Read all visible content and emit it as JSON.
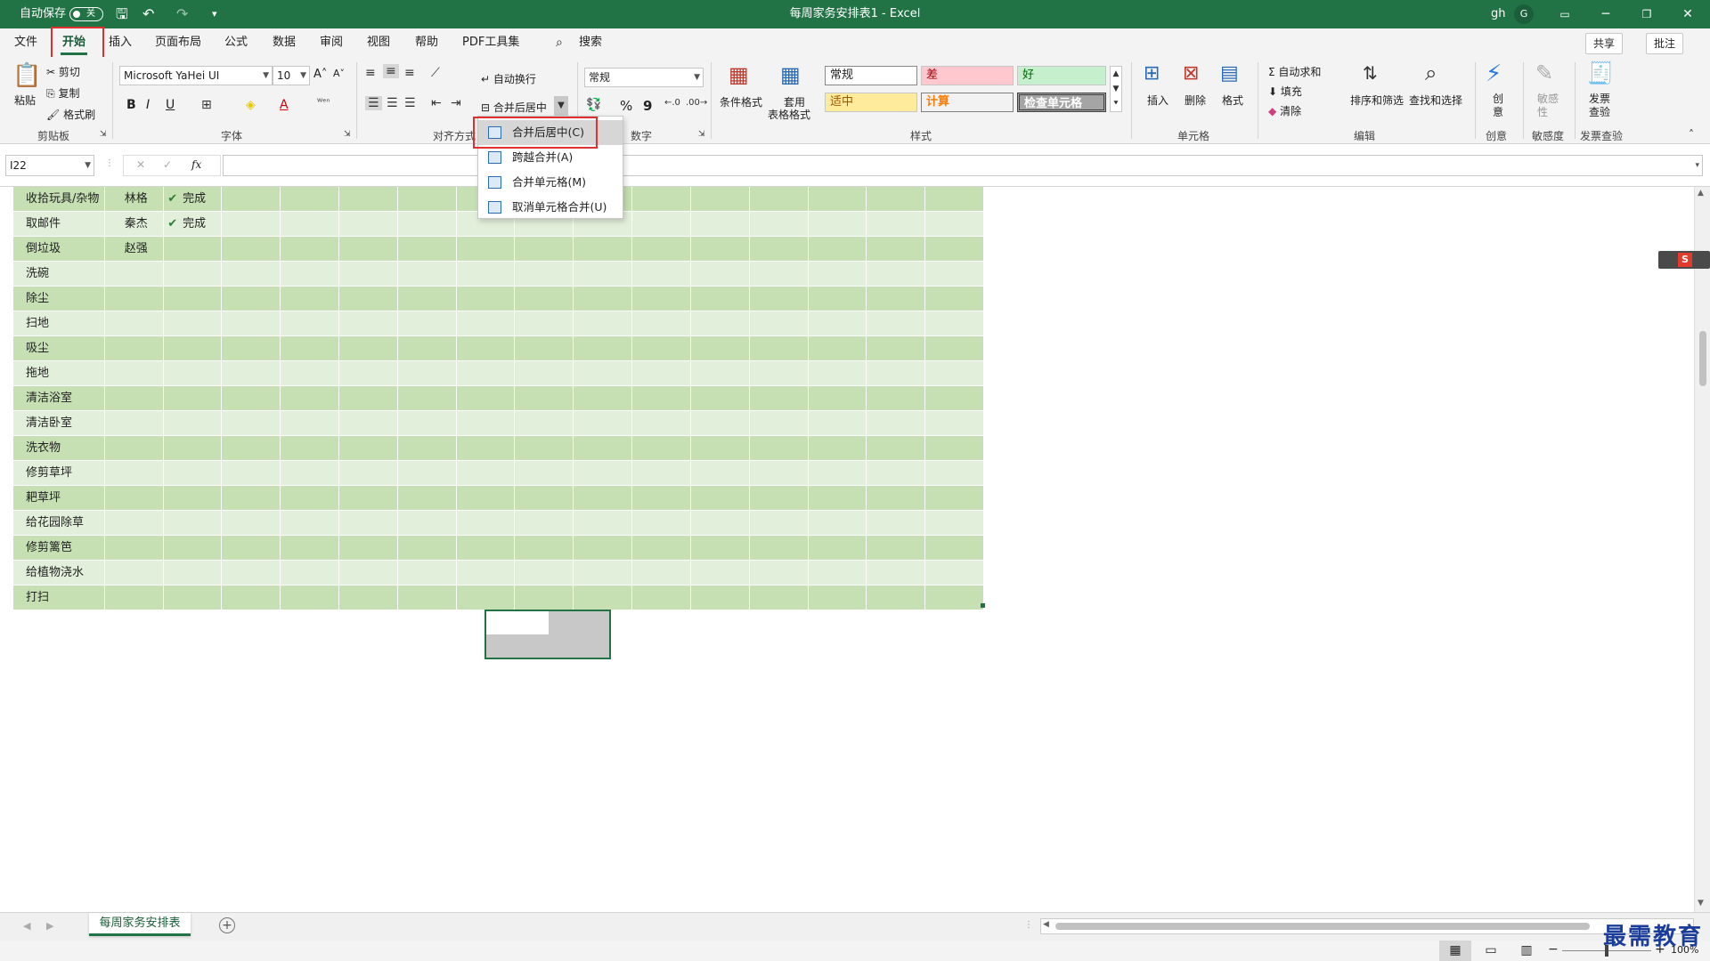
{
  "titlebar": {
    "autosave_label": "自动保存",
    "autosave_state": "关",
    "title": "每周家务安排表1  -  Excel",
    "user": "gh",
    "avatar_letter": "G"
  },
  "tabs": [
    "文件",
    "开始",
    "插入",
    "页面布局",
    "公式",
    "数据",
    "审阅",
    "视图",
    "帮助",
    "PDF工具集"
  ],
  "search_label": "搜索",
  "share_label": "共享",
  "comment_label": "批注",
  "ribbon": {
    "clipboard": {
      "paste": "粘贴",
      "cut": "剪切",
      "copy": "复制",
      "painter": "格式刷",
      "label": "剪贴板"
    },
    "font": {
      "name": "Microsoft YaHei UI",
      "size": "10",
      "label": "字体",
      "bold": "B",
      "italic": "I",
      "underline": "U",
      "grow": "A˄",
      "shrink": "A˅",
      "fill_a": "A"
    },
    "alignment": {
      "wrap": "自动换行",
      "merge": "合并后居中",
      "label": "对齐方式"
    },
    "number": {
      "format": "常规",
      "percent": "%",
      "comma": "9",
      "label": "数字"
    },
    "styles": {
      "cond": "条件格式",
      "table": "套用",
      "table2": "表格格式",
      "normal": "常规",
      "bad": "差",
      "good": "好",
      "neutral": "适中",
      "calc": "计算",
      "check": "检查单元格",
      "label": "样式"
    },
    "cells": {
      "insert": "插入",
      "delete": "删除",
      "format": "格式",
      "label": "单元格"
    },
    "editing": {
      "autosum": "自动求和",
      "fill": "填充",
      "clear": "清除",
      "sort": "排序和筛选",
      "find": "查找和选择",
      "label": "编辑"
    },
    "creative": {
      "name": "创意",
      "label": "创意"
    },
    "sensitivity": {
      "name": "敏感性",
      "label": "敏感度"
    },
    "invoice": {
      "name": "发票查验",
      "label": "发票查验"
    }
  },
  "colors": {
    "excel_green": "#217346",
    "band_dark": "#c6e0b4",
    "band_light": "#e2efda",
    "highlight": "#e03030",
    "bad_bg": "#ffc7ce",
    "bad_fg": "#9c0006",
    "good_bg": "#c6efce",
    "good_fg": "#006100",
    "neutral_bg": "#ffeb9c",
    "neutral_fg": "#9c5700",
    "calc_fg": "#fa7d00"
  },
  "namebox": "I22",
  "formula_icons": {
    "cancel": "✕",
    "enter": "✓",
    "fx": "fx"
  },
  "dropdown": [
    {
      "label": "合并后居中(C)"
    },
    {
      "label": "跨越合并(A)"
    },
    {
      "label": "合并单元格(M)"
    },
    {
      "label": "取消单元格合并(U)"
    }
  ],
  "rows": [
    {
      "task": "收拾玩具/杂物",
      "person": "林格",
      "status": "完成"
    },
    {
      "task": "取邮件",
      "person": "秦杰",
      "status": "完成"
    },
    {
      "task": "倒垃圾",
      "person": "赵强",
      "status": ""
    },
    {
      "task": "洗碗",
      "person": "",
      "status": ""
    },
    {
      "task": "除尘",
      "person": "",
      "status": ""
    },
    {
      "task": "扫地",
      "person": "",
      "status": ""
    },
    {
      "task": "吸尘",
      "person": "",
      "status": ""
    },
    {
      "task": "拖地",
      "person": "",
      "status": ""
    },
    {
      "task": "清洁浴室",
      "person": "",
      "status": ""
    },
    {
      "task": "清洁卧室",
      "person": "",
      "status": ""
    },
    {
      "task": "洗衣物",
      "person": "",
      "status": ""
    },
    {
      "task": "修剪草坪",
      "person": "",
      "status": ""
    },
    {
      "task": "耙草坪",
      "person": "",
      "status": ""
    },
    {
      "task": "给花园除草",
      "person": "",
      "status": ""
    },
    {
      "task": "修剪篱笆",
      "person": "",
      "status": ""
    },
    {
      "task": "给植物浇水",
      "person": "",
      "status": ""
    },
    {
      "task": "打扫",
      "person": "",
      "status": ""
    }
  ],
  "sheet_tab": "每周家务安排表",
  "zoom": "100%",
  "watermark": "最需教育"
}
